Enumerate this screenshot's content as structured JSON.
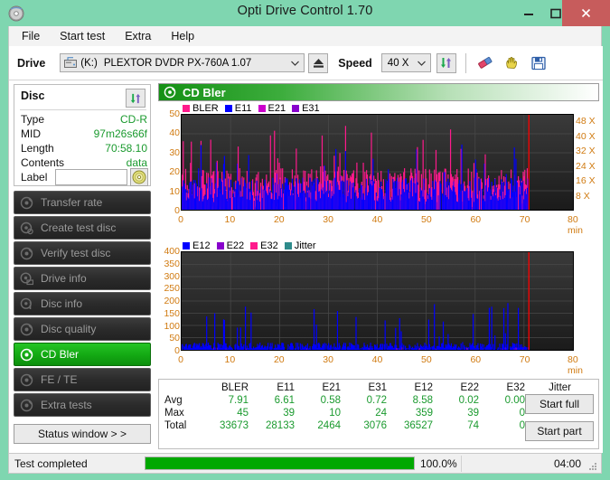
{
  "window": {
    "title": "Opti Drive Control 1.70",
    "app_icon": "disc-icon",
    "minimize_label": "–",
    "maximize_label": "□",
    "close_label": "✕",
    "close_color": "#c75c5c",
    "frame_color": "#7fd6b0"
  },
  "menu": {
    "items": [
      {
        "label": "File"
      },
      {
        "label": "Start test"
      },
      {
        "label": "Extra"
      },
      {
        "label": "Help"
      }
    ]
  },
  "toolbar": {
    "drive_label": "Drive",
    "drive_letter": "(K:)",
    "drive_name": "PLEXTOR DVDR  PX-760A 1.07",
    "eject_icon": "eject-icon",
    "speed_label": "Speed",
    "speed_value": "40 X",
    "refresh_icon": "refresh-icon",
    "erase_icon": "eraser-icon",
    "hand_icon": "hand-icon",
    "save_icon": "floppy-save-icon",
    "dropdown_icon": "chevron-down-icon"
  },
  "disc": {
    "title": "Disc",
    "refresh_icon": "refresh-icon",
    "rows": [
      {
        "key": "Type",
        "value": "CD-R"
      },
      {
        "key": "MID",
        "value": "97m26s66f"
      },
      {
        "key": "Length",
        "value": "70:58.10"
      },
      {
        "key": "Contents",
        "value": "data"
      }
    ],
    "label_key": "Label",
    "label_value": "",
    "label_placeholder": "",
    "label_button_icon": "cd-disc-icon"
  },
  "sidebar": {
    "items": [
      {
        "label": "Transfer rate",
        "icon": "disc-transfer-icon",
        "active": false
      },
      {
        "label": "Create test disc",
        "icon": "disc-create-icon",
        "active": false
      },
      {
        "label": "Verify test disc",
        "icon": "disc-verify-icon",
        "active": false
      },
      {
        "label": "Drive info",
        "icon": "disc-drive-icon",
        "active": false
      },
      {
        "label": "Disc info",
        "icon": "disc-info-icon",
        "active": false
      },
      {
        "label": "Disc quality",
        "icon": "disc-quality-icon",
        "active": false
      },
      {
        "label": "CD Bler",
        "icon": "disc-bler-icon",
        "active": true
      },
      {
        "label": "FE / TE",
        "icon": "disc-fete-icon",
        "active": false
      },
      {
        "label": "Extra tests",
        "icon": "disc-extra-icon",
        "active": false
      }
    ],
    "status_window_label": "Status window > >",
    "active_color": "#13a813"
  },
  "chart_header": {
    "title": "CD Bler",
    "icon": "disc-bler-icon"
  },
  "chart_data": [
    {
      "type": "area",
      "title": "CD Bler",
      "xlabel": "min",
      "ylabel": "",
      "xlim": [
        0,
        80
      ],
      "ylim": [
        0,
        50
      ],
      "xticks": [
        0,
        10,
        20,
        30,
        40,
        50,
        60,
        70,
        80
      ],
      "xtick_labels": [
        "0",
        "10",
        "20",
        "30",
        "40",
        "50",
        "60",
        "70",
        "80 min"
      ],
      "yticks": [
        0,
        10,
        20,
        30,
        40,
        50
      ],
      "y2label": "X",
      "y2ticks": [
        8,
        16,
        24,
        32,
        40,
        48
      ],
      "y2tick_labels": [
        "8 X",
        "16 X",
        "24 X",
        "32 X",
        "40 X",
        "48 X"
      ],
      "y2lim": [
        0,
        52
      ],
      "grid": true,
      "legend_position": "top-left",
      "data_end_marker_min": 71,
      "data_end_marker_color": "#ff0000",
      "series": [
        {
          "name": "BLER",
          "color": "#ff1a8c",
          "avg": 7.91,
          "max": 45,
          "total": 33673
        },
        {
          "name": "E11",
          "color": "#0000ff",
          "avg": 6.61,
          "max": 39,
          "total": 28133
        },
        {
          "name": "E21",
          "color": "#cc00cc",
          "avg": 0.58,
          "max": 10,
          "total": 2464
        },
        {
          "name": "E31",
          "color": "#8800cc",
          "avg": 0.72,
          "max": 24,
          "total": 3076
        }
      ]
    },
    {
      "type": "area",
      "title": "",
      "xlabel": "min",
      "ylabel": "",
      "xlim": [
        0,
        80
      ],
      "ylim": [
        0,
        400
      ],
      "xticks": [
        0,
        10,
        20,
        30,
        40,
        50,
        60,
        70,
        80
      ],
      "xtick_labels": [
        "0",
        "10",
        "20",
        "30",
        "40",
        "50",
        "60",
        "70",
        "80 min"
      ],
      "yticks": [
        0,
        50,
        100,
        150,
        200,
        250,
        300,
        350,
        400
      ],
      "grid": true,
      "legend_position": "top-left",
      "data_end_marker_min": 71,
      "data_end_marker_color": "#ff0000",
      "series": [
        {
          "name": "E12",
          "color": "#0000ff",
          "avg": 8.58,
          "max": 359,
          "total": 36527
        },
        {
          "name": "E22",
          "color": "#8800cc",
          "avg": 0.02,
          "max": 39,
          "total": 74
        },
        {
          "name": "E32",
          "color": "#ff1a8c",
          "avg": 0.0,
          "max": 0,
          "total": 0
        },
        {
          "name": "Jitter",
          "color": "#2e8b8b",
          "avg": "-",
          "max": "-",
          "total": ""
        }
      ]
    }
  ],
  "stats": {
    "columns": [
      "BLER",
      "E11",
      "E21",
      "E31",
      "E12",
      "E22",
      "E32",
      "Jitter"
    ],
    "rows": [
      {
        "label": "Avg",
        "values": [
          "7.91",
          "6.61",
          "0.58",
          "0.72",
          "8.58",
          "0.02",
          "0.00",
          "-"
        ]
      },
      {
        "label": "Max",
        "values": [
          "45",
          "39",
          "10",
          "24",
          "359",
          "39",
          "0",
          "-"
        ]
      },
      {
        "label": "Total",
        "values": [
          "33673",
          "28133",
          "2464",
          "3076",
          "36527",
          "74",
          "0",
          ""
        ]
      }
    ],
    "start_full_label": "Start full",
    "start_part_label": "Start part"
  },
  "statusbar": {
    "status_text": "Test completed",
    "progress_percent": "100.0%",
    "progress_value": 100,
    "elapsed": "04:00",
    "progress_color": "#00a800"
  }
}
